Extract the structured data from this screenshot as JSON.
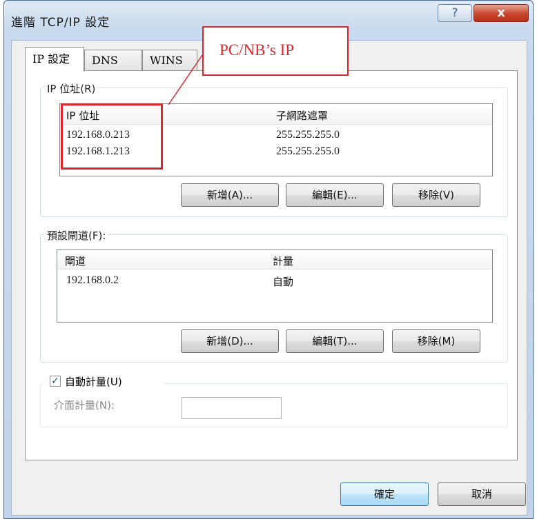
{
  "window": {
    "title": "進階 TCP/IP 設定",
    "help_icon": "?",
    "close_icon": "x"
  },
  "tabs": [
    {
      "label": "IP 設定",
      "active": true
    },
    {
      "label": "DNS",
      "active": false
    },
    {
      "label": "WINS",
      "active": false
    }
  ],
  "ip_group": {
    "label": "IP 位址(R)",
    "columns": [
      "IP 位址",
      "子網路遮罩"
    ],
    "rows": [
      [
        "192.168.0.213",
        "255.255.255.0"
      ],
      [
        "192.168.1.213",
        "255.255.255.0"
      ]
    ],
    "buttons": {
      "add": "新增(A)...",
      "edit": "編輯(E)...",
      "remove": "移除(V)"
    }
  },
  "gateway_group": {
    "label": "預設閘道(F):",
    "columns": [
      "閘道",
      "計量"
    ],
    "rows": [
      [
        "192.168.0.2",
        "自動"
      ]
    ],
    "buttons": {
      "add": "新增(D)...",
      "edit": "編輯(T)...",
      "remove": "移除(M)"
    }
  },
  "metric": {
    "auto_label": "自動計量(U)",
    "auto_checked": true,
    "interface_label": "介面計量(N):",
    "interface_value": ""
  },
  "footer": {
    "ok": "確定",
    "cancel": "取消"
  },
  "annotation": {
    "text": "PC/NB’s IP",
    "color": "#e3242b"
  }
}
